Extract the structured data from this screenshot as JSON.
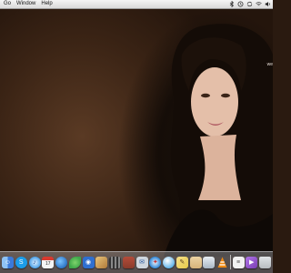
{
  "menubar": {
    "items": [
      {
        "label": "Go"
      },
      {
        "label": "Window"
      },
      {
        "label": "Help"
      }
    ],
    "status_icons": [
      "bluetooth-icon",
      "time-machine-icon",
      "sync-icon",
      "wifi-icon",
      "volume-icon"
    ]
  },
  "desktop": {
    "partial_text": "we"
  },
  "dock": {
    "items": [
      {
        "icon": "finder-icon",
        "color": "#3b79d8"
      },
      {
        "icon": "skype-icon",
        "color": "#1b9ce8"
      },
      {
        "icon": "itunes-icon",
        "color": "#4aa0e8"
      },
      {
        "icon": "calendar-icon",
        "color": "#f4f4f4"
      },
      {
        "icon": "earth-icon",
        "color": "#2d74c4"
      },
      {
        "icon": "leaf-icon",
        "color": "#3fa84a"
      },
      {
        "icon": "rss-icon",
        "color": "#2f6fcf"
      },
      {
        "icon": "photo-icon",
        "color": "#b07a3a"
      },
      {
        "icon": "film-icon",
        "color": "#6a6a6a"
      },
      {
        "icon": "photo-booth-icon",
        "color": "#8a3b2b"
      },
      {
        "icon": "mail-icon",
        "color": "#cfd6dd"
      },
      {
        "icon": "safari-icon",
        "color": "#2f86d6"
      },
      {
        "icon": "chat-icon",
        "color": "#5ab0e8"
      },
      {
        "icon": "pencil-icon",
        "color": "#e6c84a"
      },
      {
        "icon": "folder-icon",
        "color": "#d7b37a"
      },
      {
        "icon": "preview-icon",
        "color": "#a9b6c4"
      },
      {
        "icon": "vlc-cone-icon",
        "color": "#f08a12"
      },
      {
        "icon": "text-editor-icon",
        "color": "#f1f1f1"
      },
      {
        "icon": "media-player-icon",
        "color": "#7b3fb3"
      },
      {
        "icon": "trash-icon",
        "color": "#b8bcc0"
      }
    ]
  }
}
